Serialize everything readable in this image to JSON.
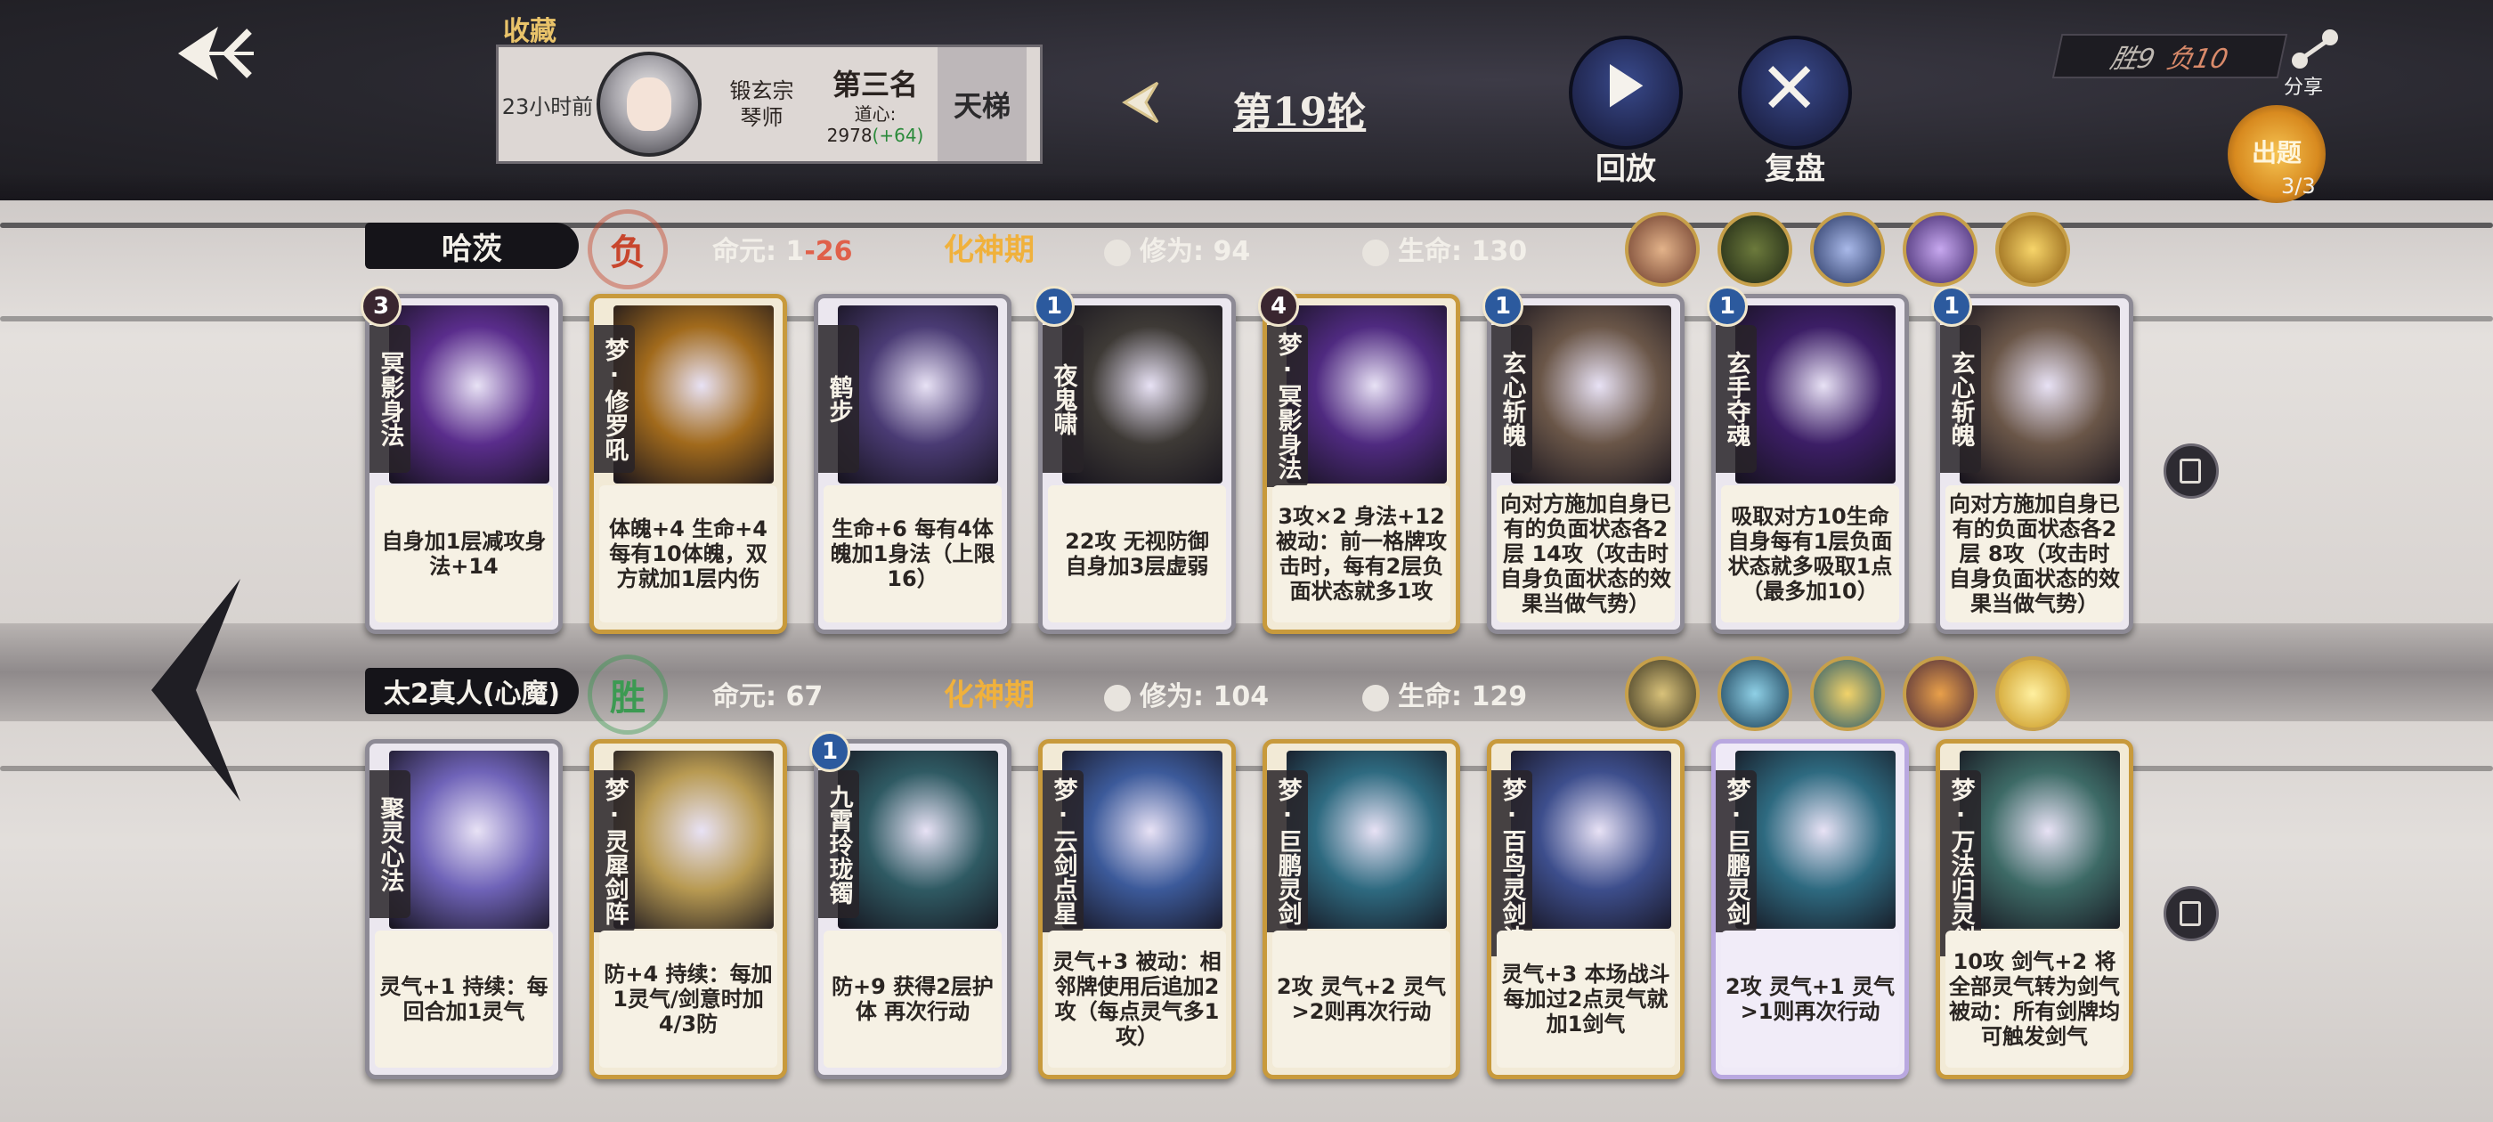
{
  "header": {
    "collect_label": "收藏",
    "profile": {
      "time": "23小时前",
      "sect": "锻玄宗",
      "role": "琴师",
      "rank": "第三名",
      "daoxin_label": "道心:",
      "daoxin_value": "2978",
      "daoxin_gain": "(+64)",
      "ladder": "天梯"
    },
    "round": "第19轮",
    "replay": "回放",
    "review": "复盘",
    "score_win": "胜9",
    "score_lose": "负10",
    "share": "分享",
    "quiz": "出题",
    "quiz_count": "3/3"
  },
  "players": [
    {
      "name": "哈茨",
      "result": "负",
      "mingyuan_label": "命元:",
      "mingyuan_value": "1",
      "mingyuan_delta": "-26",
      "realm": "化神期",
      "xiuwei": "修为: 94",
      "life": "生命: 130",
      "icons": [
        "character-portrait-icon",
        "shadow-beast-icon",
        "swordsman-icon",
        "purple-spirit-icon",
        "sun-orb-icon"
      ],
      "cards": [
        {
          "name": "冥影身法",
          "level": "3",
          "frame": "silver",
          "art": "#5a2d8c",
          "text": "自身加1层减攻身法+14"
        },
        {
          "name": "梦·修罗吼",
          "level": "",
          "frame": "gold",
          "art": "#a16a1c",
          "text": "体魄+4 生命+4 每有10体魄，双方就加1层内伤"
        },
        {
          "name": "鹤步",
          "level": "",
          "frame": "silver",
          "art": "#4a3b74",
          "text": "生命+6 每有4体魄加1身法（上限16）"
        },
        {
          "name": "夜鬼啸",
          "level": "1",
          "frame": "silver",
          "art": "#3e3a36",
          "text": "22攻 无视防御 自身加3层虚弱"
        },
        {
          "name": "梦·冥影身法",
          "level": "4",
          "frame": "gold",
          "art": "#4f2a80",
          "text": "3攻×2 身法+12 被动：前一格牌攻击时，每有2层负面状态就多1攻"
        },
        {
          "name": "玄心斩魄",
          "level": "1",
          "frame": "silver",
          "art": "#6a5648",
          "text": "向对方施加自身已有的负面状态各2层 14攻（攻击时自身负面状态的效果当做气势）"
        },
        {
          "name": "玄手夺魂",
          "level": "1",
          "frame": "silver",
          "art": "#3c1e66",
          "text": "吸取对方10生命 自身每有1层负面状态就多吸取1点（最多加10）"
        },
        {
          "name": "玄心斩魄",
          "level": "1",
          "frame": "silver",
          "art": "#6a5648",
          "text": "向对方施加自身已有的负面状态各2层 8攻（攻击时自身负面状态的效果当做气势）"
        }
      ]
    },
    {
      "name": "太2真人(心魔)",
      "result": "胜",
      "mingyuan_label": "命元:",
      "mingyuan_value": "67",
      "mingyuan_delta": "",
      "realm": "化神期",
      "xiuwei": "修为: 104",
      "life": "生命: 129",
      "icons": [
        "spiral-talisman-icon",
        "crystal-blade-icon",
        "golden-swirl-icon",
        "fire-phoenix-icon",
        "golden-sun-icon"
      ],
      "cards": [
        {
          "name": "聚灵心法",
          "level": "",
          "frame": "silver",
          "art": "#6f63b8",
          "text": "灵气+1 持续：每回合加1灵气"
        },
        {
          "name": "梦·灵犀剑阵",
          "level": "",
          "frame": "gold",
          "art": "#b89a52",
          "text": "防+4 持续：每加1灵气/剑意时加4/3防"
        },
        {
          "name": "九霄玲珑镯",
          "level": "1",
          "frame": "silver",
          "art": "#2f5a63",
          "text": "防+9 获得2层护体 再次行动"
        },
        {
          "name": "梦·云剑点星",
          "level": "",
          "frame": "gold",
          "art": "#3c5a9a",
          "text": "灵气+3 被动：相邻牌使用后追加2攻（每点灵气多1攻）"
        },
        {
          "name": "梦·巨鹏灵剑",
          "level": "",
          "frame": "gold",
          "art": "#2e6a80",
          "text": "2攻 灵气+2 灵气>2则再次行动"
        },
        {
          "name": "梦·百鸟灵剑诀",
          "level": "",
          "frame": "gold",
          "art": "#3d4e8c",
          "text": "灵气+3 本场战斗每加过2点灵气就加1剑气"
        },
        {
          "name": "梦·巨鹏灵剑",
          "level": "",
          "frame": "purple",
          "art": "#2e6a80",
          "text": "2攻 灵气+1 灵气>1则再次行动"
        },
        {
          "name": "梦·万法归灵剑",
          "level": "",
          "frame": "gold",
          "art": "#3d6a66",
          "text": "10攻 剑气+2 将全部灵气转为剑气 被动：所有剑牌均可触发剑气"
        }
      ]
    }
  ],
  "colors": {
    "gold_frame": "#c89a3c",
    "lose": "#c8462d",
    "win": "#3c9a52",
    "realm": "#f0b13c"
  }
}
